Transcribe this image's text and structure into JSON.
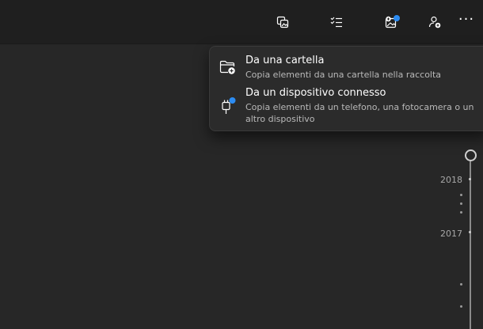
{
  "toolbar": {
    "buttons": [
      {
        "name": "slideshow",
        "icon": "photos-stack-icon"
      },
      {
        "name": "select",
        "icon": "checklist-icon"
      },
      {
        "name": "import",
        "icon": "image-add-icon",
        "badge": true
      },
      {
        "name": "people",
        "icon": "person-add-icon"
      },
      {
        "name": "more",
        "icon": "more-options-icon",
        "label": "···"
      }
    ],
    "accent_color": "#2c8cf2"
  },
  "import_menu": {
    "items": [
      {
        "icon": "folder-add-icon",
        "title": "Da una cartella",
        "description": "Copia elementi da una cartella nella raccolta"
      },
      {
        "icon": "usb-device-icon",
        "title": "Da un dispositivo connesso",
        "description": "Copia elementi da un telefono, una fotocamera o un altro dispositivo"
      }
    ]
  },
  "timeline": {
    "years": [
      "2018",
      "2017"
    ]
  }
}
